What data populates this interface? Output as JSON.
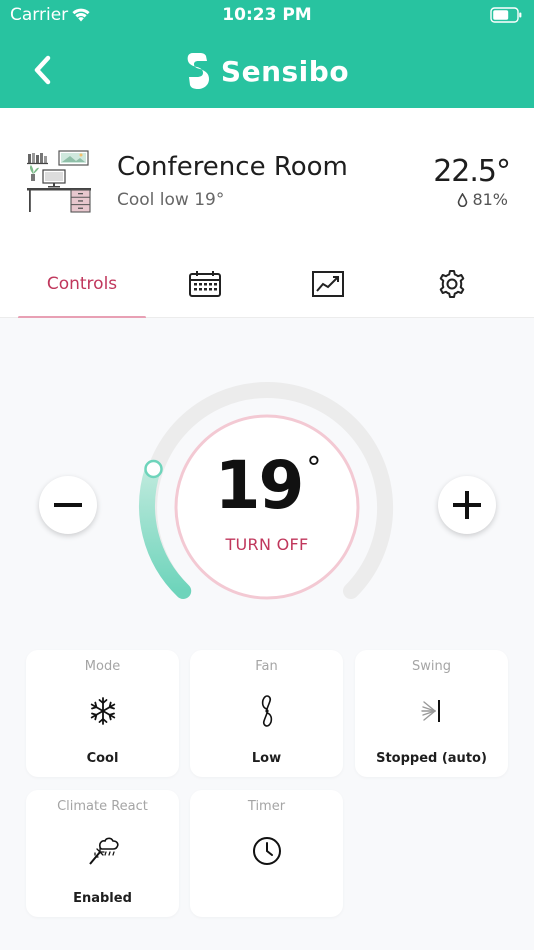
{
  "status": {
    "carrier": "Carrier",
    "time": "10:23 PM"
  },
  "nav": {
    "brand": "Sensibo"
  },
  "room": {
    "name": "Conference Room",
    "subtitle": "Cool low 19°",
    "temperature": "22.5°",
    "humidity": "81%"
  },
  "tabs": {
    "controls_label": "Controls",
    "active": "Controls"
  },
  "dial": {
    "target_temp": "19",
    "degree_symbol": "°",
    "power_label": "TURN OFF"
  },
  "cards": {
    "mode": {
      "title": "Mode",
      "value": "Cool",
      "icon": "snowflake-icon"
    },
    "fan": {
      "title": "Fan",
      "value": "Low",
      "icon": "fan-icon"
    },
    "swing": {
      "title": "Swing",
      "value": "Stopped (auto)",
      "icon": "swing-icon"
    },
    "climate": {
      "title": "Climate React",
      "value": "Enabled",
      "icon": "climate-react-icon"
    },
    "timer": {
      "title": "Timer",
      "value": "",
      "icon": "clock-icon"
    }
  },
  "colors": {
    "brand": "#28c3a0",
    "accent": "#c0375c",
    "dial_progress": "#7fd9c4"
  }
}
